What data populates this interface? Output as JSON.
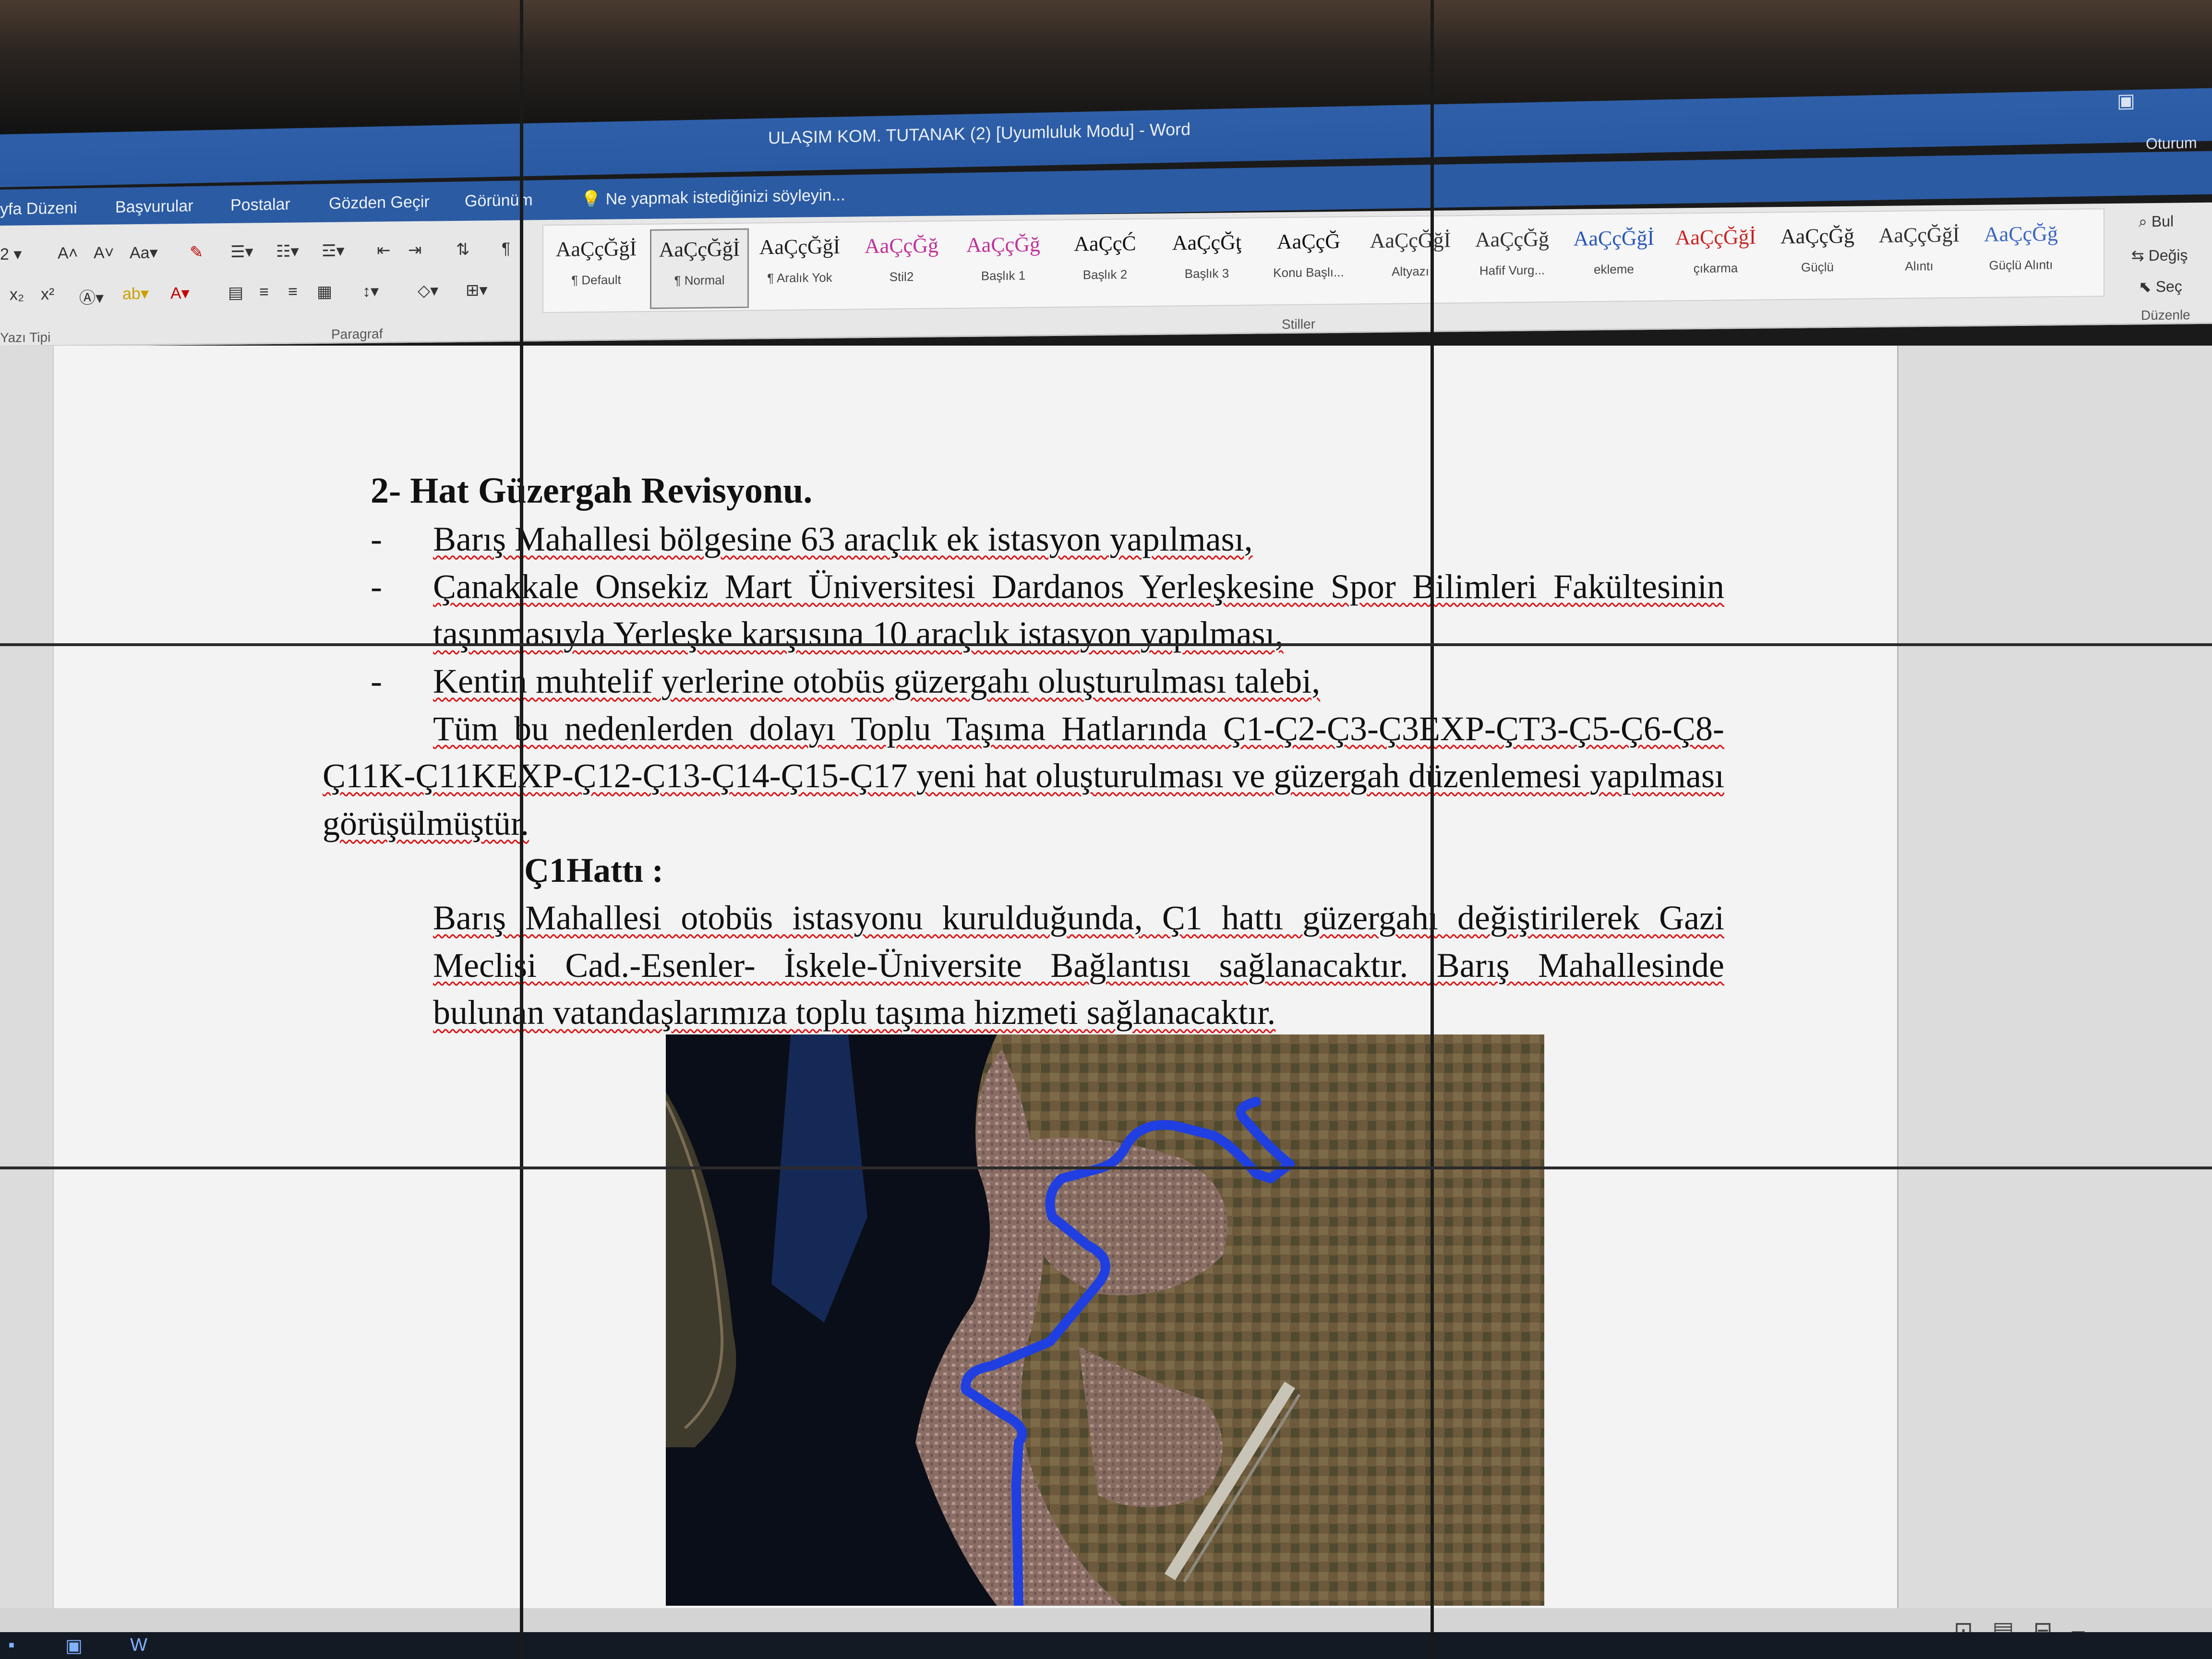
{
  "titlebar": {
    "title": "ULAŞIM KOM. TUTANAK (2) [Uyumluluk Modu] - Word",
    "sign_in": "Oturum"
  },
  "menu": {
    "tabs": [
      "yfa Düzeni",
      "Başvurular",
      "Postalar",
      "Gözden Geçir",
      "Görünüm"
    ],
    "tell_me": "Ne yapmak istediğinizi söyleyin..."
  },
  "ribbon": {
    "font_group_label": "Yazı Tipi",
    "paragraph_group_label": "Paragraf",
    "styles_group_label": "Stiller",
    "editing_group_label": "Düzenle",
    "styles": [
      {
        "preview": "AaÇçĞğİ",
        "name": "¶ Default",
        "color": "#222222"
      },
      {
        "preview": "AaÇçĞğİ",
        "name": "¶ Normal",
        "color": "#222222"
      },
      {
        "preview": "AaÇçĞğİ",
        "name": "¶ Aralık Yok",
        "color": "#222222"
      },
      {
        "preview": "AaÇçĞğ",
        "name": "Stil2",
        "color": "#c0309a"
      },
      {
        "preview": "AaÇçĞğ",
        "name": "Başlık 1",
        "color": "#c0309a"
      },
      {
        "preview": "AaÇçĆ",
        "name": "Başlık 2",
        "color": "#111111"
      },
      {
        "preview": "AaÇçĞţ",
        "name": "Başlık 3",
        "color": "#111111"
      },
      {
        "preview": "AaÇçĞ",
        "name": "Konu Başlı...",
        "color": "#111111"
      },
      {
        "preview": "AaÇçĞğİ",
        "name": "Altyazı",
        "color": "#333333"
      },
      {
        "preview": "AaÇçĞğ",
        "name": "Hafif Vurg...",
        "color": "#333333"
      },
      {
        "preview": "AaÇçĞğİ",
        "name": "ekleme",
        "color": "#2857b8"
      },
      {
        "preview": "AaÇçĞğİ",
        "name": "çıkarma",
        "color": "#cc2222"
      },
      {
        "preview": "AaÇçĞğ",
        "name": "Güçlü",
        "color": "#222222"
      },
      {
        "preview": "AaÇçĞğİ",
        "name": "Alıntı",
        "color": "#333333"
      },
      {
        "preview": "AaÇçĞğ",
        "name": "Güçlü Alıntı",
        "color": "#3a66c4"
      }
    ],
    "editing": {
      "find": "Bul",
      "replace": "Değiş",
      "select": "Seç"
    }
  },
  "document": {
    "heading": "2- Hat Güzergah Revisyonu.",
    "bullets": [
      "Barış Mahallesi bölgesine 63 araçlık ek istasyon yapılması,",
      "Çanakkale Onsekiz Mart Üniversitesi Dardanos Yerleşkesine Spor Bilimleri Fakültesinin taşınmasıyla Yerleşke karşısına 10 araçlık istasyon yapılması,",
      "Kentin muhtelif yerlerine otobüs güzergahı oluşturulması talebi,"
    ],
    "summary": "Tüm bu nedenlerden dolayı Toplu Taşıma Hatlarında Ç1-Ç2-Ç3-Ç3EXP-ÇT3-Ç5-Ç6-Ç8-Ç11K-Ç11KEXP-Ç12-Ç13-Ç14-Ç15-Ç17 yeni hat oluşturulması ve güzergah düzenlemesi yapılması görüşülmüştür.",
    "subheading": "Ç1Hattı :",
    "body": "Barış Mahallesi otobüs istasyonu kurulduğunda, Ç1 hattı güzergahı değiştirilerek Gazi Meclisi Cad.-Esenler- İskele-Üniversite Bağlantısı sağlanacaktır. Barış Mahallesinde bulunan vatandaşlarımıza toplu taşıma hizmeti sağlanacaktır.",
    "route_color": "#1f3fe0"
  }
}
